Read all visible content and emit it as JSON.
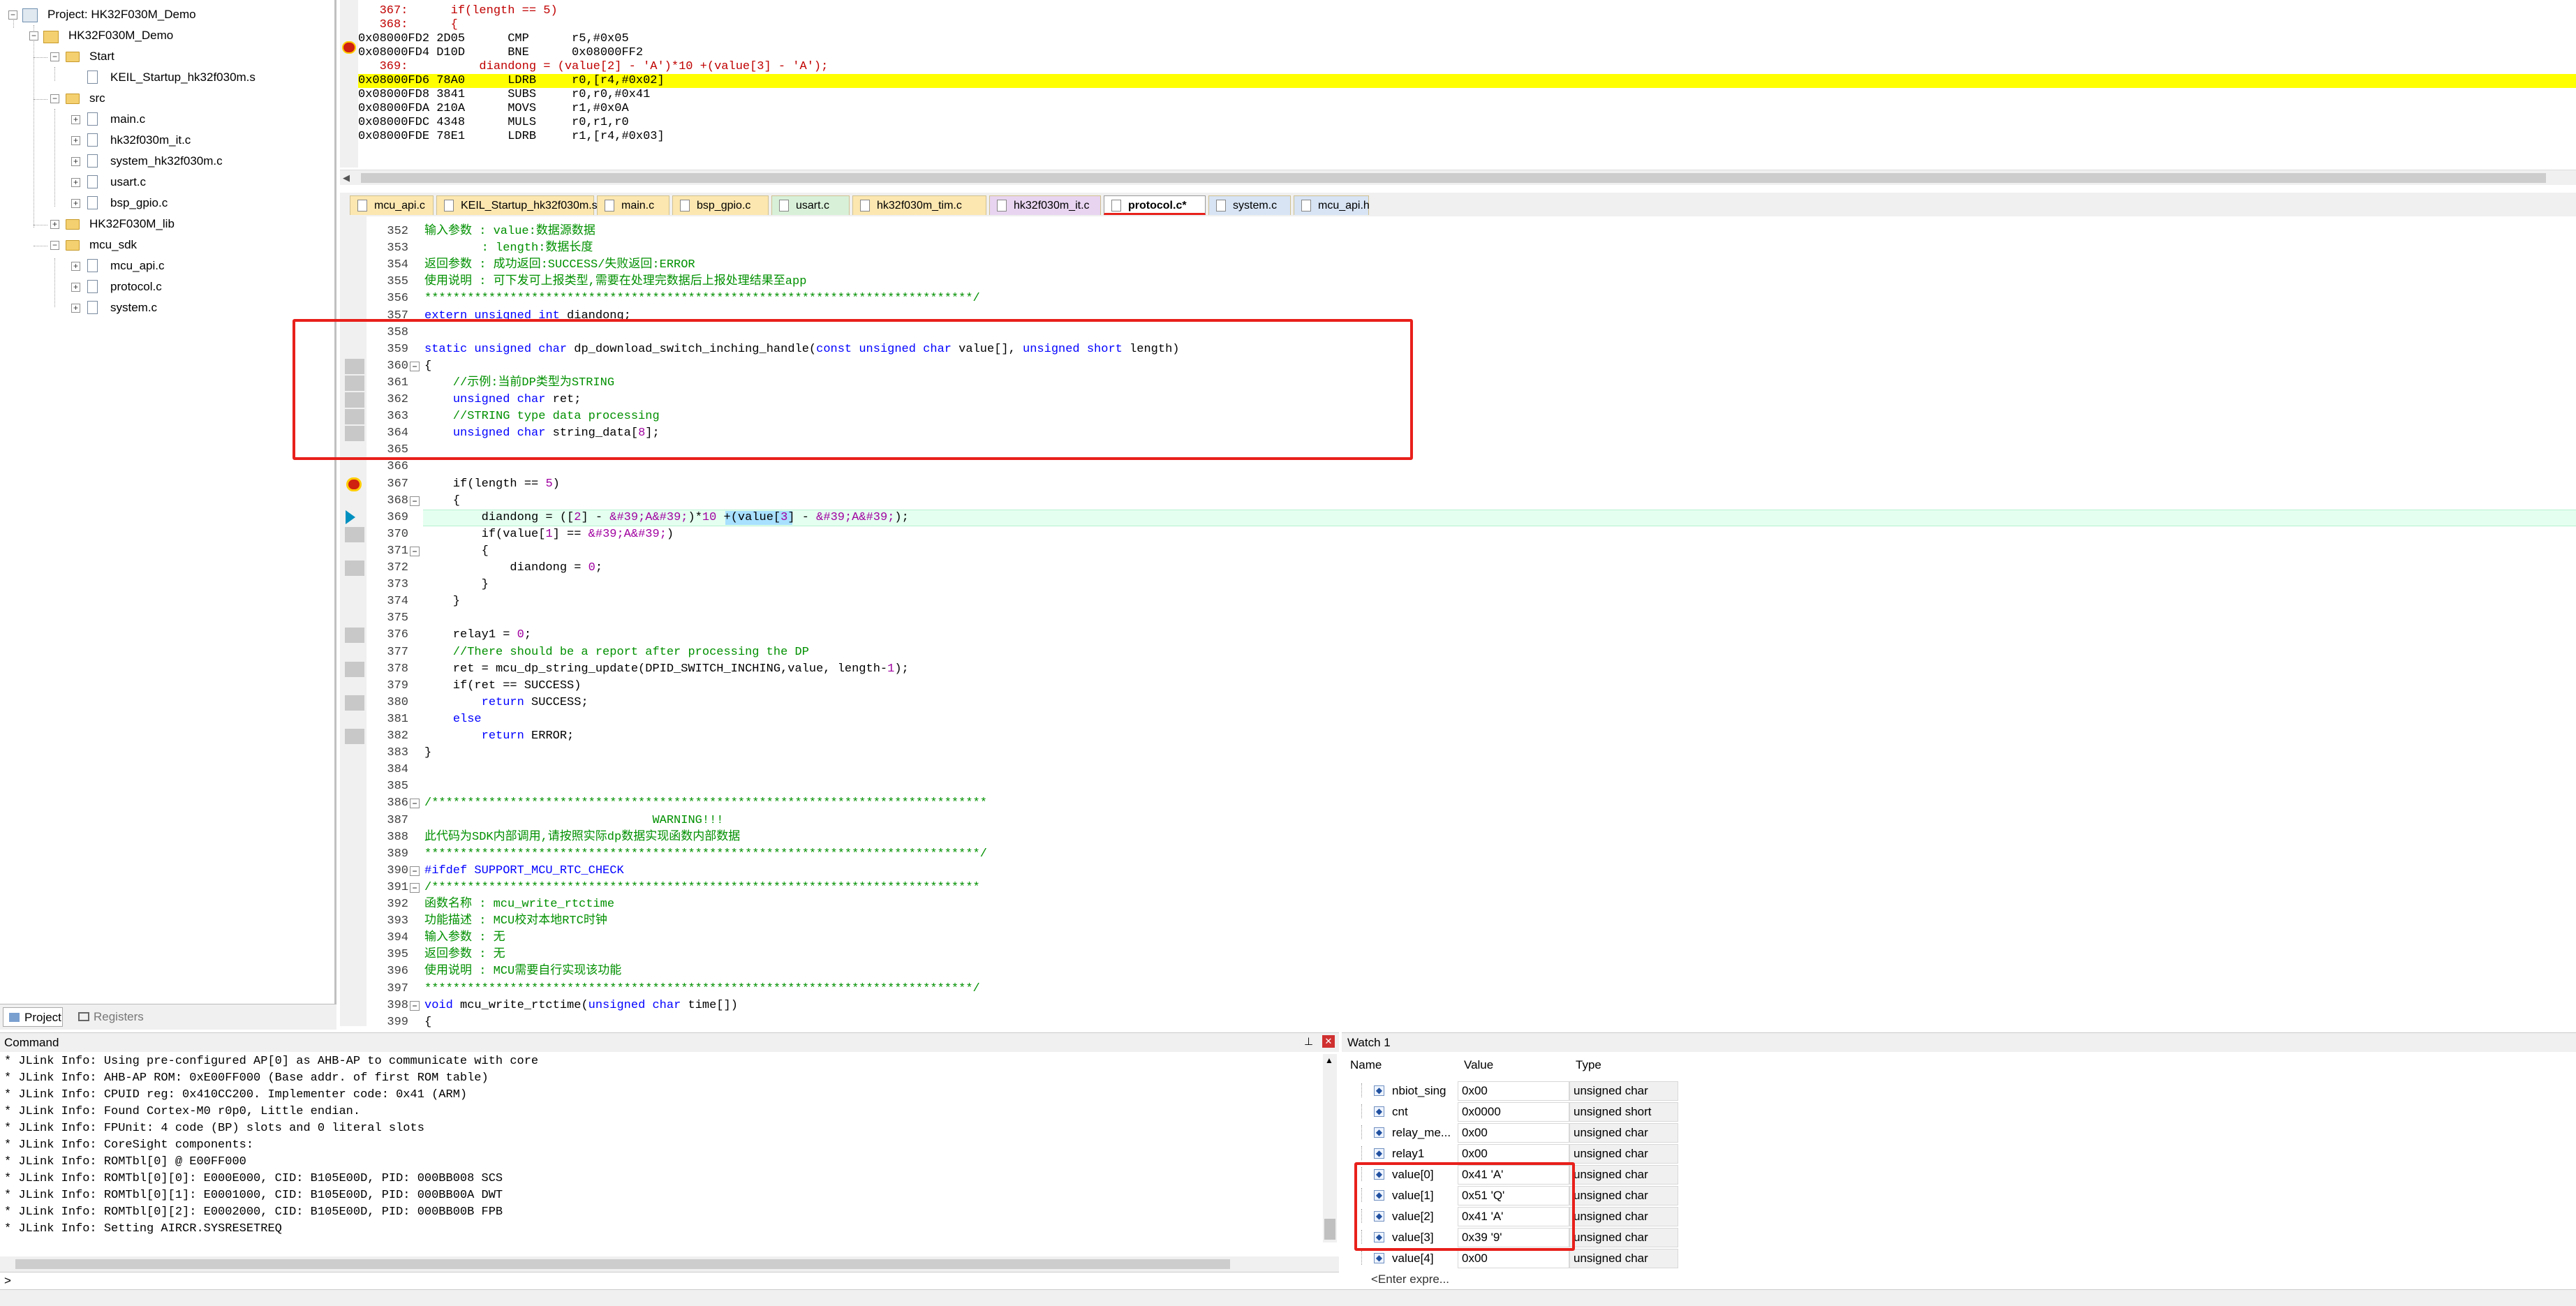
{
  "project": {
    "root": "Project: HK32F030M_Demo",
    "target": "HK32F030M_Demo",
    "groups": [
      {
        "name": "Start",
        "files": [
          "KEIL_Startup_hk32f030m.s"
        ]
      },
      {
        "name": "src",
        "files": [
          "main.c",
          "hk32f030m_it.c",
          "system_hk32f030m.c",
          "usart.c",
          "bsp_gpio.c"
        ]
      },
      {
        "name": "HK32F030M_lib",
        "files": []
      },
      {
        "name": "mcu_sdk",
        "files": [
          "mcu_api.c",
          "protocol.c",
          "system.c"
        ]
      }
    ],
    "tabs": [
      "Project",
      "Registers"
    ]
  },
  "disassembly": {
    "lines": [
      {
        "text": "   367:      if(length == 5)",
        "type": "src"
      },
      {
        "text": "   368:      {",
        "type": "src"
      },
      {
        "text": "0x08000FD2 2D05      CMP      r5,#0x05",
        "type": "asm",
        "marker": true
      },
      {
        "text": "0x08000FD4 D10D      BNE      0x08000FF2",
        "type": "asm"
      },
      {
        "text": "   369:          diandong = (value[2] - 'A')*10 +(value[3] - 'A');",
        "type": "src"
      },
      {
        "text": "0x08000FD6 78A0      LDRB     r0,[r4,#0x02]",
        "type": "asm",
        "hl": true
      },
      {
        "text": "0x08000FD8 3841      SUBS     r0,r0,#0x41",
        "type": "asm"
      },
      {
        "text": "0x08000FDA 210A      MOVS     r1,#0x0A",
        "type": "asm"
      },
      {
        "text": "0x08000FDC 4348      MULS     r0,r1,r0",
        "type": "asm"
      },
      {
        "text": "0x08000FDE 78E1      LDRB     r1,[r4,#0x03]",
        "type": "asm"
      }
    ]
  },
  "tabs": [
    "mcu_api.c",
    "KEIL_Startup_hk32f030m.s",
    "main.c",
    "bsp_gpio.c",
    "usart.c",
    "hk32f030m_tim.c",
    "hk32f030m_it.c",
    "protocol.c*",
    "system.c",
    "mcu_api.h"
  ],
  "active_tab": "protocol.c*",
  "editor": {
    "lines": [
      {
        "n": "352",
        "t": "输入参数 : value:数据源数据",
        "c": "cm"
      },
      {
        "n": "353",
        "t": "        : length:数据长度",
        "c": "cm"
      },
      {
        "n": "354",
        "t": "返回参数 : 成功返回:SUCCESS/失败返回:ERROR",
        "c": "cm"
      },
      {
        "n": "355",
        "t": "使用说明 : 可下发可上报类型,需要在处理完数据后上报处理结果至app",
        "c": "cm"
      },
      {
        "n": "356",
        "t": "*****************************************************************************/",
        "c": "cm"
      },
      {
        "n": "357",
        "t": "extern unsigned int diandong;",
        "c": "mix1"
      },
      {
        "n": "358",
        "t": "",
        "c": ""
      },
      {
        "n": "359",
        "t": "static unsigned char dp_download_switch_inching_handle(const unsigned char value[], unsigned short length)",
        "c": "mix2"
      },
      {
        "n": "360",
        "t": "{",
        "c": ""
      },
      {
        "n": "361",
        "t": "    //示例:当前DP类型为STRING",
        "c": "cm"
      },
      {
        "n": "362",
        "t": "    unsigned char ret;",
        "c": "mix3"
      },
      {
        "n": "363",
        "t": "    //STRING type data processing",
        "c": "cm"
      },
      {
        "n": "364",
        "t": "    unsigned char string_data[8];",
        "c": "mix4"
      },
      {
        "n": "365",
        "t": "",
        "c": ""
      },
      {
        "n": "366",
        "t": "",
        "c": ""
      },
      {
        "n": "367",
        "t": "    if(length == 5)",
        "c": "mix5"
      },
      {
        "n": "368",
        "t": "    {",
        "c": ""
      },
      {
        "n": "369",
        "t": "        diandong = ([2] - 'A')*10 +(value[3] - 'A');",
        "c": "cur"
      },
      {
        "n": "370",
        "t": "        if(value[1] == 'A')",
        "c": "mix6"
      },
      {
        "n": "371",
        "t": "        {",
        "c": ""
      },
      {
        "n": "372",
        "t": "            diandong = 0;",
        "c": "mix7"
      },
      {
        "n": "373",
        "t": "        }",
        "c": ""
      },
      {
        "n": "374",
        "t": "    }",
        "c": ""
      },
      {
        "n": "375",
        "t": "",
        "c": ""
      },
      {
        "n": "376",
        "t": "    relay1 = 0;",
        "c": "mix7"
      },
      {
        "n": "377",
        "t": "    //There should be a report after processing the DP",
        "c": "cm"
      },
      {
        "n": "378",
        "t": "    ret = mcu_dp_string_update(DPID_SWITCH_INCHING,value, length-1);",
        "c": "mix8"
      },
      {
        "n": "379",
        "t": "    if(ret == SUCCESS)",
        "c": ""
      },
      {
        "n": "380",
        "t": "        return SUCCESS;",
        "c": "mix9"
      },
      {
        "n": "381",
        "t": "    else",
        "c": "kw"
      },
      {
        "n": "382",
        "t": "        return ERROR;",
        "c": "mix9"
      },
      {
        "n": "383",
        "t": "}",
        "c": ""
      },
      {
        "n": "384",
        "t": "",
        "c": ""
      },
      {
        "n": "385",
        "t": "",
        "c": ""
      },
      {
        "n": "386",
        "t": "/******************************************************************************",
        "c": "cm"
      },
      {
        "n": "387",
        "t": "                                WARNING!!!",
        "c": "cm"
      },
      {
        "n": "388",
        "t": "此代码为SDK内部调用,请按照实际dp数据实现函数内部数据",
        "c": "cm"
      },
      {
        "n": "389",
        "t": "******************************************************************************/",
        "c": "cm"
      },
      {
        "n": "390",
        "t": "#ifdef SUPPORT_MCU_RTC_CHECK",
        "c": "pp"
      },
      {
        "n": "391",
        "t": "/*****************************************************************************",
        "c": "cm"
      },
      {
        "n": "392",
        "t": "函数名称 : mcu_write_rtctime",
        "c": "cm"
      },
      {
        "n": "393",
        "t": "功能描述 : MCU校对本地RTC时钟",
        "c": "cm"
      },
      {
        "n": "394",
        "t": "输入参数 : 无",
        "c": "cm"
      },
      {
        "n": "395",
        "t": "返回参数 : 无",
        "c": "cm"
      },
      {
        "n": "396",
        "t": "使用说明 : MCU需要自行实现该功能",
        "c": "cm"
      },
      {
        "n": "397",
        "t": "*****************************************************************************/",
        "c": "cm"
      },
      {
        "n": "398",
        "t": "void mcu_write_rtctime(unsigned char time[])",
        "c": "mix10"
      },
      {
        "n": "399",
        "t": "{",
        "c": ""
      }
    ]
  },
  "command": {
    "title": "Command",
    "lines": [
      "* JLink Info: Using pre-configured AP[0] as AHB-AP to communicate with core",
      "* JLink Info: AHB-AP ROM: 0xE00FF000 (Base addr. of first ROM table)",
      "* JLink Info: CPUID reg: 0x410CC200. Implementer code: 0x41 (ARM)",
      "* JLink Info: Found Cortex-M0 r0p0, Little endian.",
      "* JLink Info: FPUnit: 4 code (BP) slots and 0 literal slots",
      "* JLink Info: CoreSight components:",
      "* JLink Info: ROMTbl[0] @ E00FF000",
      "* JLink Info: ROMTbl[0][0]: E000E000, CID: B105E00D, PID: 000BB008 SCS",
      "* JLink Info: ROMTbl[0][1]: E0001000, CID: B105E00D, PID: 000BB00A DWT",
      "* JLink Info: ROMTbl[0][2]: E0002000, CID: B105E00D, PID: 000BB00B FPB",
      "* JLink Info: Setting AIRCR.SYSRESETREQ"
    ]
  },
  "watch": {
    "title": "Watch 1",
    "headers": [
      "Name",
      "Value",
      "Type"
    ],
    "rows": [
      {
        "name": "nbiot_sing",
        "value": "0x00",
        "type": "unsigned char"
      },
      {
        "name": "cnt",
        "value": "0x0000",
        "type": "unsigned short"
      },
      {
        "name": "relay_me...",
        "value": "0x00",
        "type": "unsigned char"
      },
      {
        "name": "relay1",
        "value": "0x00",
        "type": "unsigned char"
      },
      {
        "name": "value[0]",
        "value": "0x41 'A'",
        "type": "unsigned char"
      },
      {
        "name": "value[1]",
        "value": "0x51 'Q'",
        "type": "unsigned char"
      },
      {
        "name": "value[2]",
        "value": "0x41 'A'",
        "type": "unsigned char"
      },
      {
        "name": "value[3]",
        "value": "0x39 '9'",
        "type": "unsigned char"
      },
      {
        "name": "value[4]",
        "value": "0x00",
        "type": "unsigned char"
      }
    ],
    "enter": "<Enter expre..."
  },
  "colors": {
    "accent_red": "#e8201b",
    "current_line": "#ffff00",
    "keyword": "#0000ff",
    "comment": "#009000"
  }
}
